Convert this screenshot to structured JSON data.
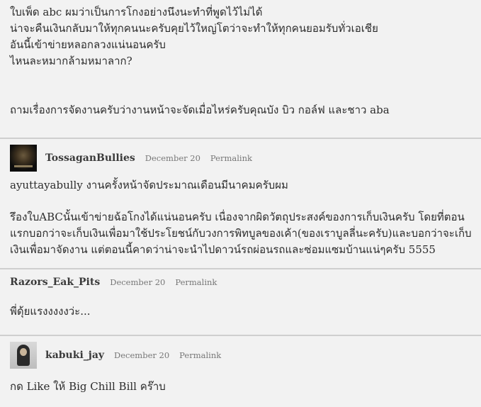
{
  "comments": [
    {
      "author": "",
      "lines_paragraphs": [
        [
          "ใบเพ็ด abc ผมว่าเป็นการโกงอย่างนึงนะทำที่พูดไว้ไม่ได้",
          "น่าจะคืนเงินกลับมาให้ทุกคนนะครับคุยไว้ใหญ่โตว่าจะทำให้ทุกคนยอมรับทั่วเอเชีย",
          "อันนี้เข้าข่ายหลอกลวงแน่นอนครับ",
          "ไหนละหมากล้ามหมาลาก?"
        ],
        [
          "ถามเรื่องการจัดงานครับว่างานหน้าจะจัดเมื่อไหร่ครับคุณบัง บิว กอล์ฟ และชาว aba"
        ]
      ]
    },
    {
      "author": "TossaganBullies",
      "avatar": "tossagan-avatar",
      "date": "December 20",
      "permalink": "Permalink",
      "lines_paragraphs": [
        [
          "ayuttayabully งานครั้งหน้าจัดประมาณเดือนมีนาคมครับผม"
        ],
        [
          "รึองใบABCนั้นเข้าข่ายฉ้อโกงได้แน่นอนครับ เนื่องจากผิดวัตถุประสงค์ของการเก็บเงินครับ โดยที่ตอน",
          "แรกบอกว่าจะเก็บเงินเพื่อมาใช้ประโยชน์กับวงการพิทบูลของเค้า(ของเราบูลลี่นะครับ)และบอกว่าจะเก็บ",
          "เงินเพื่อมาจัดงาน แต่ตอนนี้คาดว่าน่าจะนำไปดาวน์รถผ่อนรถและซ่อมแซมบ้านแน่ๆครับ 5555"
        ]
      ]
    },
    {
      "author": "Razors_Eak_Pits",
      "date": "December 20",
      "permalink": "Permalink",
      "lines_paragraphs": [
        [
          "พี่ดุ้ยแรงงงงงว่ะ..."
        ]
      ]
    },
    {
      "author": "kabuki_jay",
      "avatar": "kabuki-avatar",
      "date": "December 20",
      "permalink": "Permalink",
      "lines_paragraphs": [
        [
          "กด Like ให้ Big Chill Bill คร๊าบ"
        ]
      ]
    }
  ]
}
